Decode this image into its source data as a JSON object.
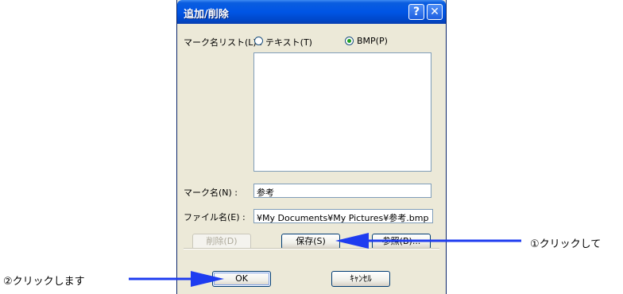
{
  "dialog": {
    "title": "追加/削除",
    "help_button": "?",
    "close_button": "✕",
    "mark_list_label": "マーク名リスト(L) :",
    "radio_text_label": "テキスト(T)",
    "radio_bmp_label": "BMP(P)",
    "selected_radio": "BMP(P)",
    "mark_name_label": "マーク名(N) :",
    "mark_name_value": "参考",
    "file_name_label": "ファイル名(E) :",
    "file_name_value": "¥My Documents¥My Pictures¥参考.bmp",
    "delete_button": "削除(D)",
    "save_button": "保存(S)",
    "browse_button": "参照(B)...",
    "ok_button": "OK",
    "cancel_button": "ｷｬﾝｾﾙ"
  },
  "annotations": {
    "step1": "①クリックして",
    "step2": "②クリックします",
    "arrow_color": "#1e3cf0"
  },
  "colors": {
    "dialog_bg": "#ece9d8",
    "titlebar": "#0055e5"
  }
}
